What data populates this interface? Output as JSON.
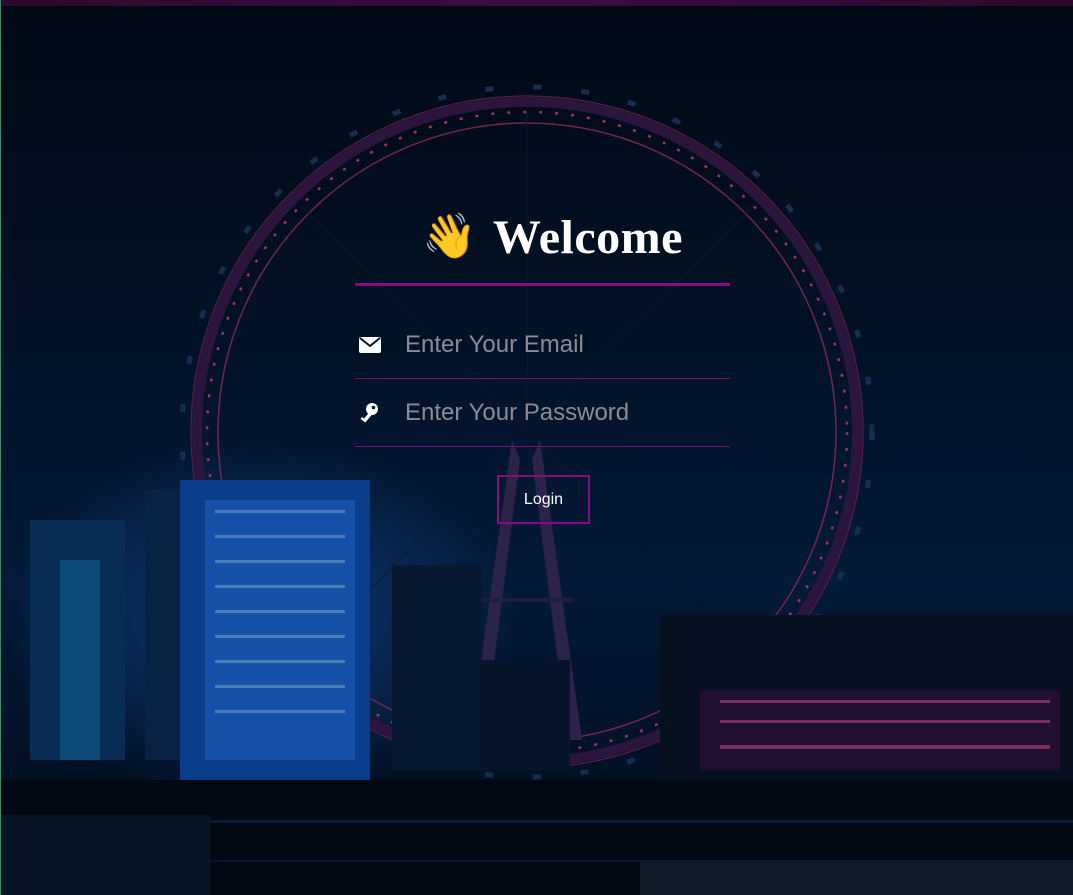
{
  "login": {
    "title": "Welcome",
    "title_icon": "waving-hand-icon",
    "email": {
      "placeholder": "Enter Your Email",
      "icon": "envelope-icon",
      "value": ""
    },
    "password": {
      "placeholder": "Enter Your Password",
      "icon": "key-icon",
      "value": ""
    },
    "button_label": "Login"
  },
  "colors": {
    "accent": "#8a0a86",
    "background": "#03152a",
    "text": "#ffffff",
    "placeholder": "#8b8b95"
  }
}
